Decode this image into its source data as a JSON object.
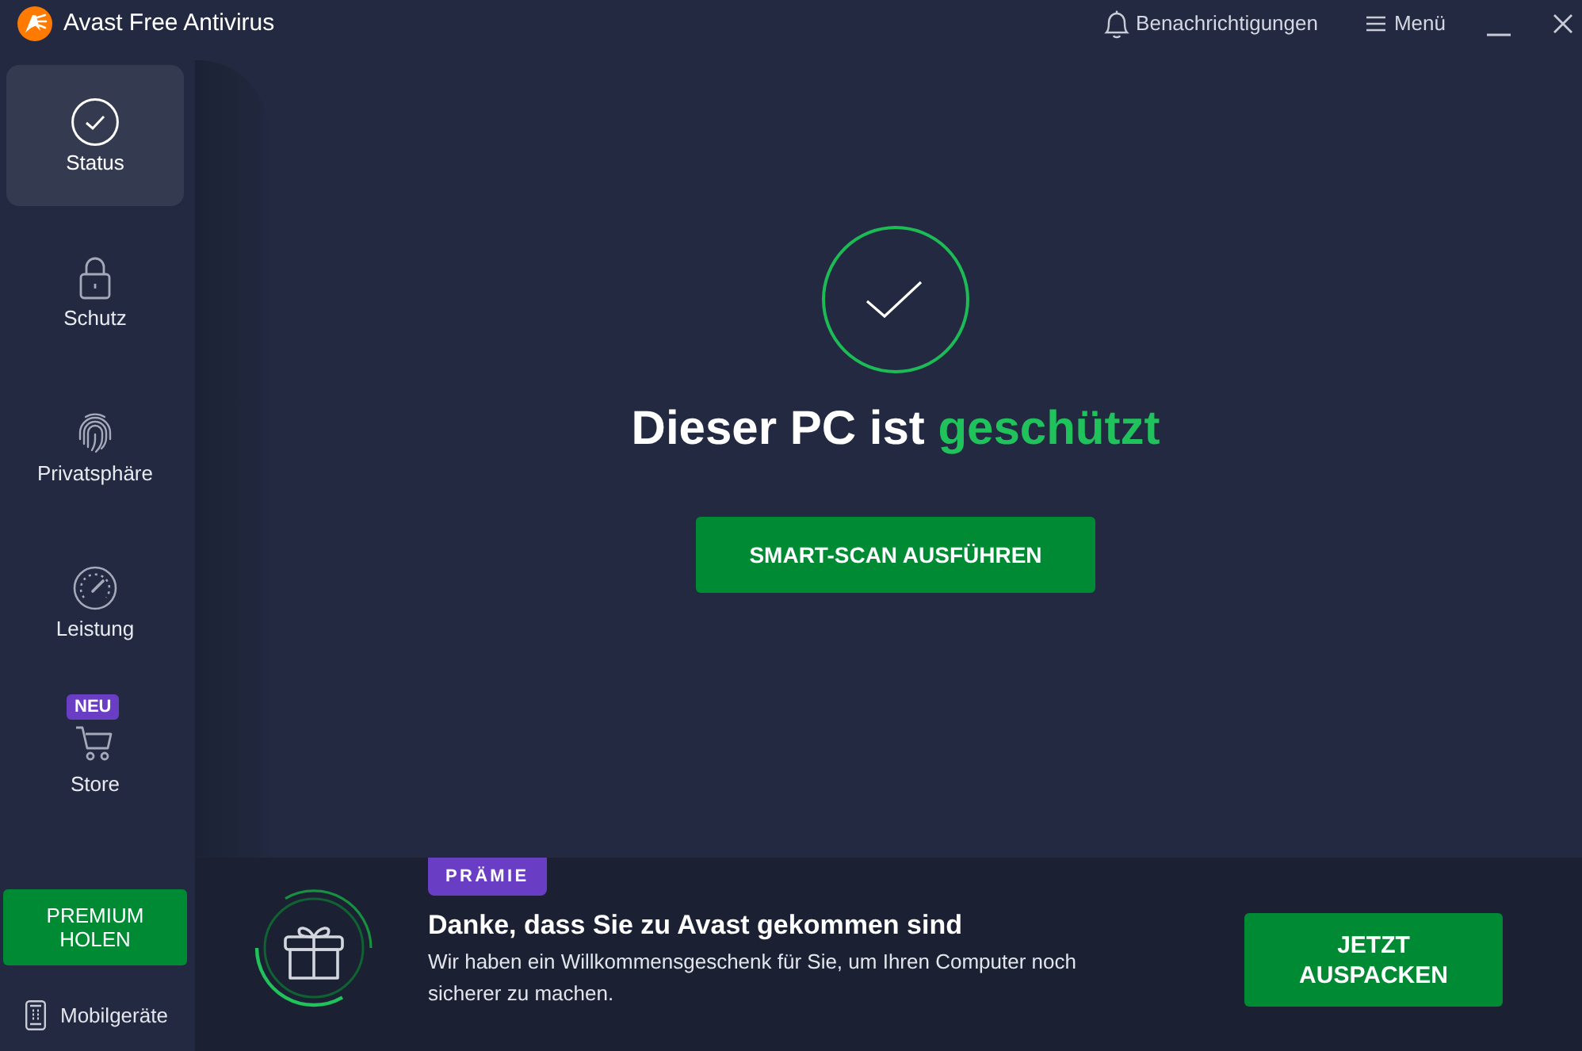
{
  "window": {
    "title": "Avast Free Antivirus"
  },
  "header": {
    "notifications": "Benachrichtigungen",
    "menu": "Menü"
  },
  "sidebar": {
    "items": [
      {
        "label": "Status",
        "selected": true
      },
      {
        "label": "Schutz",
        "selected": false
      },
      {
        "label": "Privatsphäre",
        "selected": false
      },
      {
        "label": "Leistung",
        "selected": false
      },
      {
        "label": "Store",
        "selected": false,
        "badge": "NEU"
      }
    ],
    "premium_button": "PREMIUM HOLEN",
    "mobile_link": "Mobilgeräte"
  },
  "status": {
    "heading": "Dieser PC ist",
    "heading_highlight": "geschützt",
    "scan_button": "SMART-SCAN AUSFÜHREN"
  },
  "banner": {
    "badge": "PRÄMIE",
    "title": "Danke, dass Sie zu Avast gekommen sind",
    "text": "Wir haben ein Willkommensgeschenk für Sie, um Ihren Computer noch sicherer zu machen.",
    "button": "JETZT AUSPACKEN"
  }
}
